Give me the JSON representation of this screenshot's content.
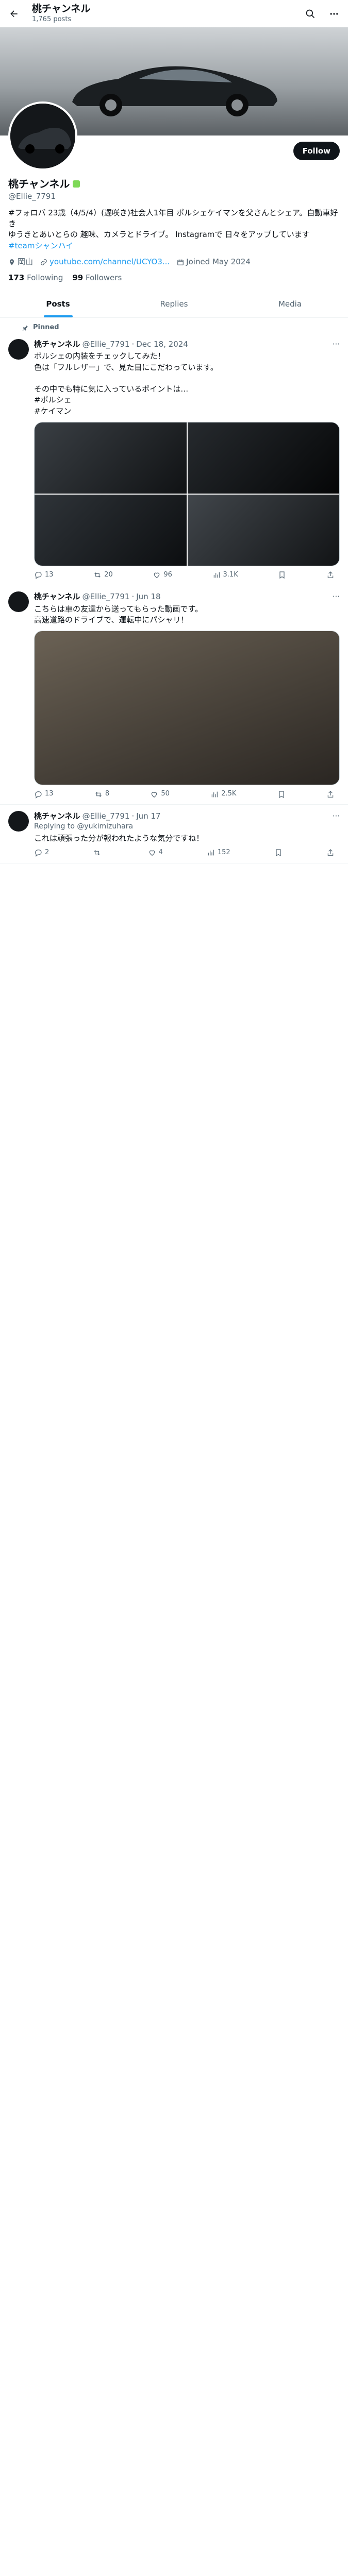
{
  "header": {
    "name": "桃チャンネル",
    "posts": "1,765 posts"
  },
  "profile": {
    "display_name": "桃チャンネル",
    "handle": "@Ellie_7791",
    "follow_label": "Follow",
    "bio_line1": "#フォロバ 23歳（4/5/4）(遅咲き)社会人1年目 ポルシェケイマンを父さんとシェア。自動車好き",
    "bio_line2": "ゆうきとあいとらの 趣味、カメラとドライブ。 Instagramで 日々をアップしています",
    "bio_link": "#teamシャンハイ",
    "location": "岡山",
    "url": "youtube.com/channel/UCYO3...",
    "joined": "Joined May 2024",
    "following_count": "173",
    "following_label": "Following",
    "followers_count": "99",
    "followers_label": "Followers"
  },
  "tabs": [
    {
      "label": "Posts"
    },
    {
      "label": "Replies"
    },
    {
      "label": "Media"
    }
  ],
  "pinned_label": "Pinned",
  "tweets": [
    {
      "name": "桃チャンネル",
      "handle": "@Ellie_7791",
      "time": "Dec 18, 2024",
      "text": "ポルシェの内装をチェックしてみた！\n色は「フルレザー」で、見た目にこだわっています。\n\nその中でも特に気に入っているポイントは…\n#ポルシェ\n#ケイマン",
      "replies": "13",
      "retweets": "20",
      "likes": "96",
      "views": "3.1K"
    },
    {
      "name": "桃チャンネル",
      "handle": "@Ellie_7791",
      "time": "Jun 18",
      "text": "こちらは車の友達から送ってもらった動画です。\n高速道路のドライブで、運転中にパシャリ！",
      "replies": "13",
      "retweets": "8",
      "likes": "50",
      "views": "2.5K"
    },
    {
      "name": "桃チャンネル",
      "handle": "@Ellie_7791",
      "time": "Jun 17",
      "reply_to": "Replying to @yukimizuhara",
      "text": "これは頑張った分が報われたような気分ですね！",
      "replies": "2",
      "retweets": "",
      "likes": "4",
      "views": "152"
    }
  ]
}
